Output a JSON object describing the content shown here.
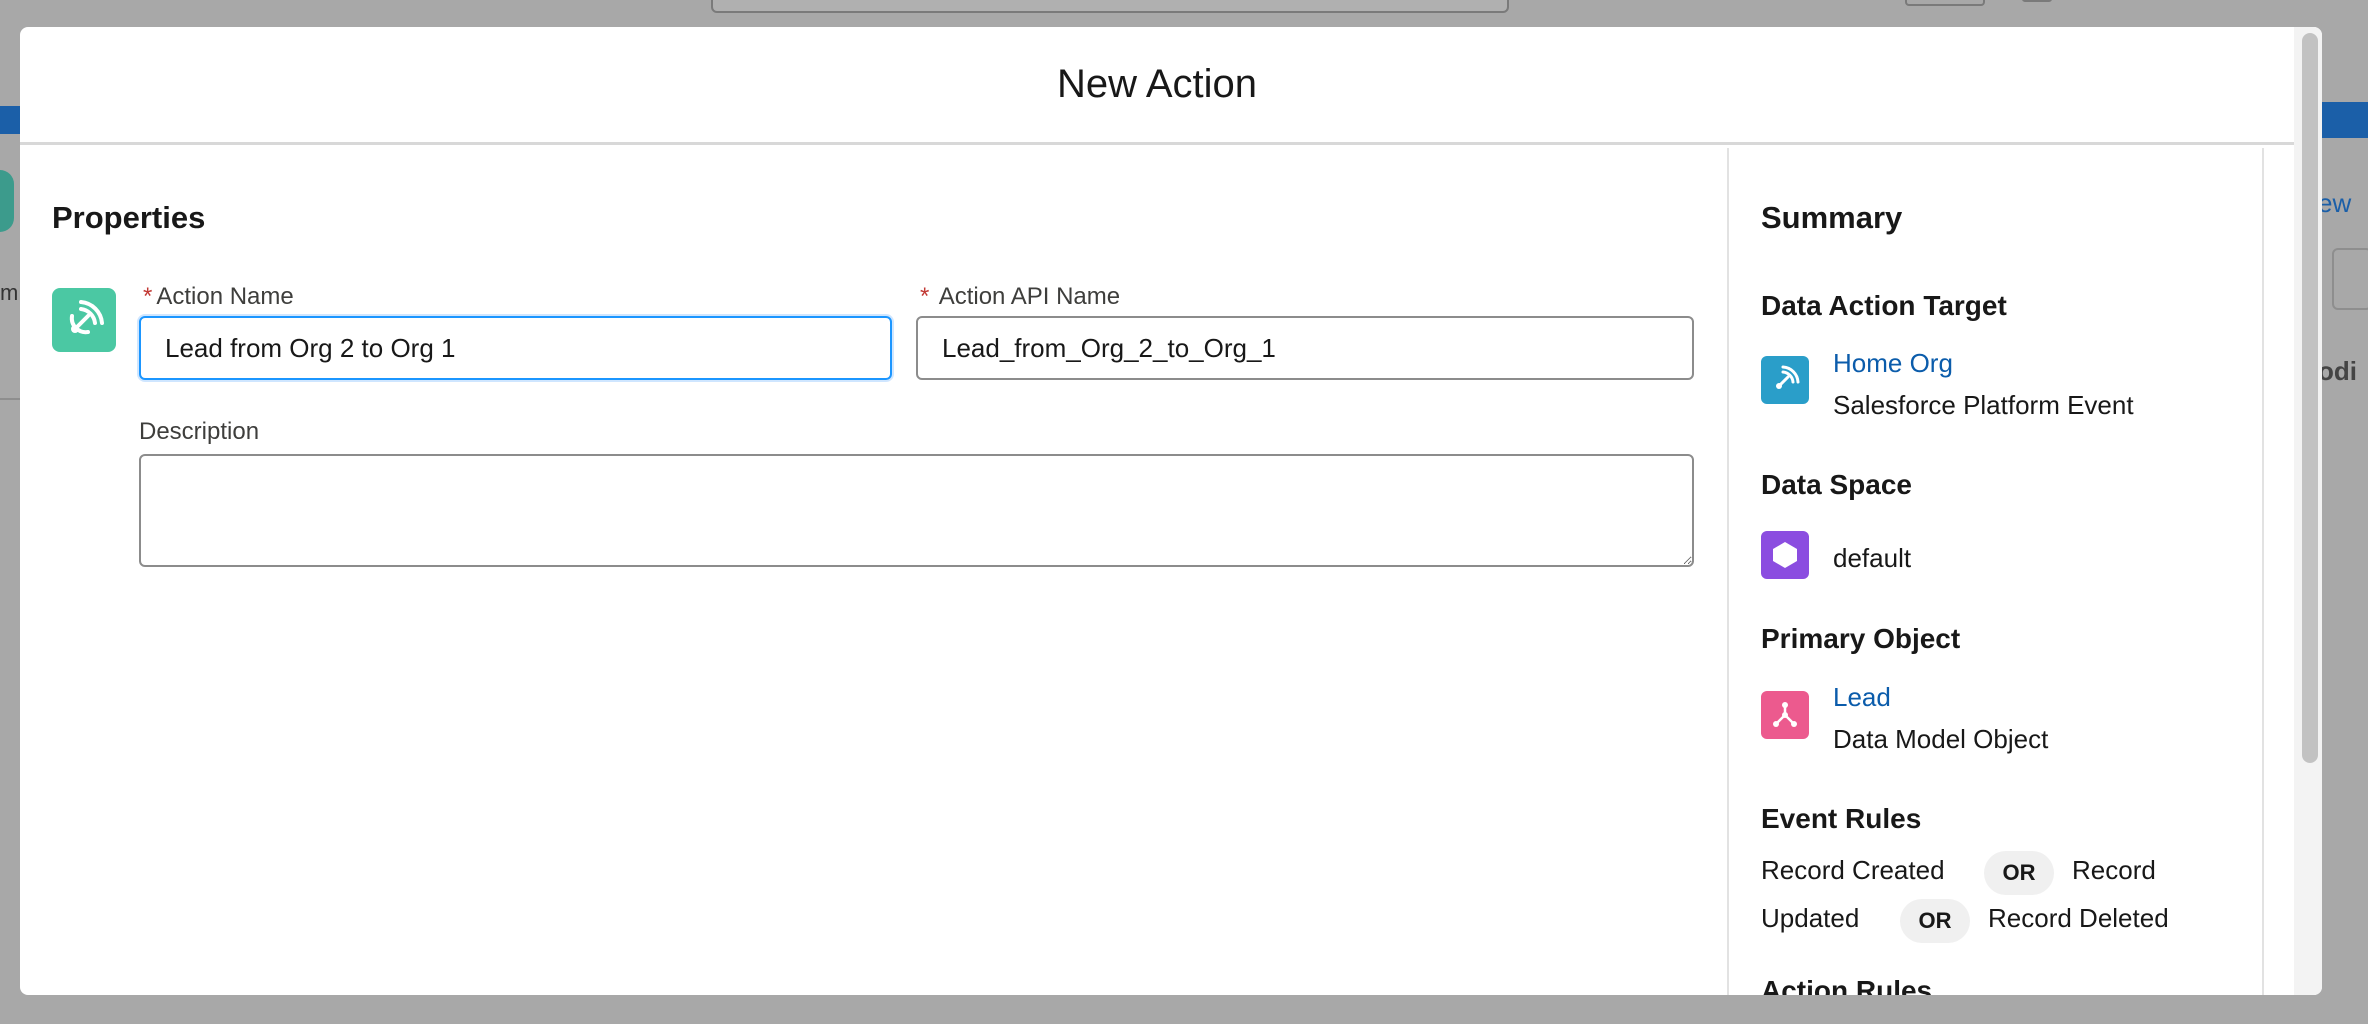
{
  "modal": {
    "title": "New Action"
  },
  "properties": {
    "title": "Properties",
    "action_name_label": "Action Name",
    "action_name_value": "Lead from Org 2 to Org 1",
    "action_api_name_label": "Action API Name",
    "action_api_name_value": "Lead_from_Org_2_to_Org_1",
    "description_label": "Description",
    "description_value": ""
  },
  "summary": {
    "title": "Summary",
    "data_action_target": {
      "heading": "Data Action Target",
      "link": "Home Org",
      "subtitle": "Salesforce Platform Event",
      "icon": "broadcast-icon",
      "icon_color": "#2a9ec9"
    },
    "data_space": {
      "heading": "Data Space",
      "value": "default",
      "icon": "hexagon-icon",
      "icon_color": "#8b4de0"
    },
    "primary_object": {
      "heading": "Primary Object",
      "link": "Lead",
      "subtitle": "Data Model Object",
      "icon": "data-model-icon",
      "icon_color": "#ec5a8e"
    },
    "event_rules": {
      "heading": "Event Rules",
      "line1": [
        "Record Created",
        "OR",
        "Record"
      ],
      "line2": [
        "Updated",
        "OR",
        "Record Deleted"
      ]
    },
    "action_rules": {
      "heading": "Action Rules"
    }
  },
  "background": {
    "left_text": "m",
    "right_link": "ew",
    "right_text": "odi"
  },
  "colors": {
    "link": "#0b5cab",
    "focus": "#1b96ff",
    "action_icon": "#4bc8a3",
    "required": "#c23934"
  }
}
